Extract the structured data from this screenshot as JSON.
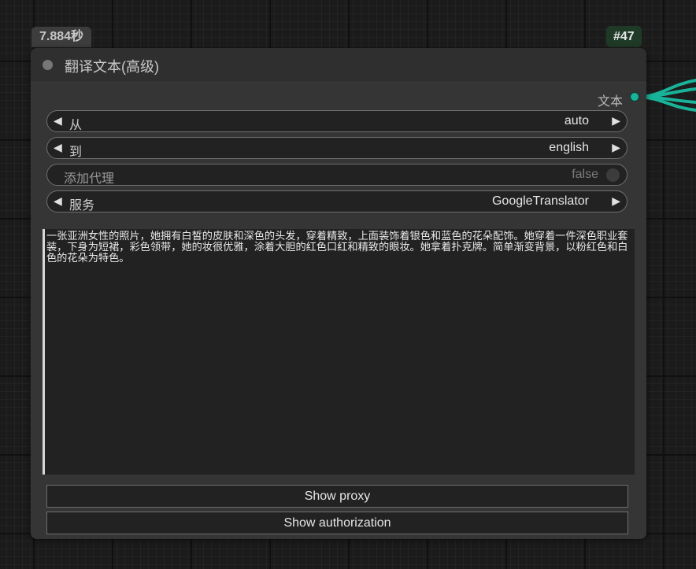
{
  "execution_time": "7.884秒",
  "node_id": "#47",
  "node": {
    "title": "翻译文本(高级)",
    "output_label": "文本",
    "widgets": {
      "from": {
        "label": "从",
        "value": "auto"
      },
      "to": {
        "label": "到",
        "value": "english"
      },
      "add_proxy": {
        "label": "添加代理",
        "value": "false"
      },
      "service": {
        "label": "服务",
        "value": "GoogleTranslator"
      }
    },
    "text": "一张亚洲女性的照片，她拥有白皙的皮肤和深色的头发，穿着精致，上面装饰着银色和蓝色的花朵配饰。她穿着一件深色职业套装，下身为短裙，彩色领带，她的妆很优雅，涂着大胆的红色口红和精致的眼妆。她拿着扑克牌。简单渐变背景，以粉红色和白色的花朵为特色。",
    "buttons": {
      "show_proxy": "Show proxy",
      "show_authorization": "Show authorization"
    }
  },
  "colors": {
    "wire": "#19b39a",
    "id_badge_bg": "#1f3a26"
  },
  "icons": {
    "left_arrow": "◀",
    "right_arrow": "▶"
  }
}
